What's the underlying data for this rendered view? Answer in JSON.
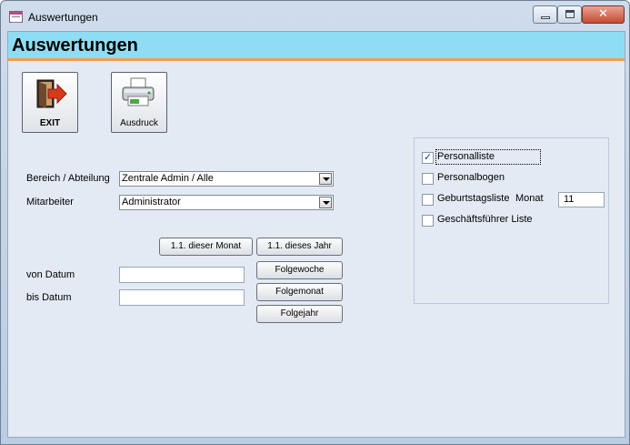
{
  "window": {
    "title": "Auswertungen",
    "controls": {
      "minimize": "minimize",
      "maximize": "maximize",
      "close": "✕"
    }
  },
  "header": {
    "title": "Auswertungen"
  },
  "toolbar": {
    "exit_label": "EXIT",
    "print_label": "Ausdruck"
  },
  "form": {
    "bereich_label": "Bereich / Abteilung",
    "bereich_value": "Zentrale Admin / Alle",
    "mitarbeiter_label": "Mitarbeiter",
    "mitarbeiter_value": "Administrator",
    "von_label": "von Datum",
    "von_value": "",
    "bis_label": "bis  Datum",
    "bis_value": ""
  },
  "date_buttons": {
    "month": "1.1. dieser Monat",
    "year": "1.1. dieses Jahr",
    "next_week": "Folgewoche",
    "next_month": "Folgemonat",
    "next_year": "Folgejahr"
  },
  "options": {
    "personalliste": {
      "label": "Personalliste",
      "checked": true
    },
    "personalbogen": {
      "label": "Personalbogen",
      "checked": false
    },
    "geburtstagsliste": {
      "label": "Geburtstagsliste",
      "checked": false,
      "month_label": "Monat",
      "month_value": "11"
    },
    "geschaeftsfuehrer": {
      "label": "Geschäftsführer Liste",
      "checked": false
    }
  },
  "colors": {
    "header_band": "#8fdcf5",
    "header_accent": "#f0a050",
    "client_bg": "#e3eaf4"
  },
  "icons": {
    "exit": "exit-door-icon",
    "print": "printer-icon",
    "app": "form-icon"
  }
}
